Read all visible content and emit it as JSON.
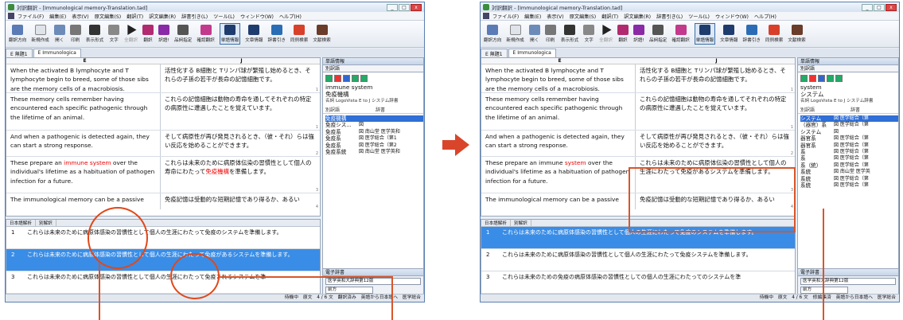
{
  "title": "対訳翻訳 - [Immunological memory-Translation.tad]",
  "menu": [
    "ファイル(F)",
    "編集(E)",
    "表示(V)",
    "原文編集(S)",
    "翻訳(T)",
    "訳文編集(R)",
    "辞書引き(L)",
    "ツール(L)",
    "ウィンドウ(W)",
    "ヘルプ(H)"
  ],
  "toolbar": [
    "翻訳方向",
    "新規作成",
    "開く",
    "印刷",
    "表示形式",
    "文字",
    "全翻訳",
    "翻訳",
    "訳語!",
    "訳語",
    "品詞指定",
    "確認翻訳",
    "単語情報",
    "文章情報",
    "辞書引き",
    "同例検索",
    "文献検索"
  ],
  "tabs": [
    "E 無題1",
    "E Immunologica"
  ],
  "colheads": {
    "e": "E",
    "j": "J"
  },
  "rows": [
    {
      "e1": "When the activated B lymphocyte and T lymphocyte begin to breed, some of those sibs are the memory cells of a macrobiosis.",
      "j1": "活性化する B細胞と Tリンパ球が繁殖し始めるとき、それらの子孫の若干が長命の記憶細胞です。",
      "n": "1"
    },
    {
      "e1": "These memory cells remember having encountered each specific pathogenic through the lifetime of an animal.",
      "j1": "これらの記憶細胞は動物の寿命を通してそれぞれの特定の病原性に遭遇したことを覚えています。",
      "n": "1"
    },
    {
      "e1": "And when a pathogenic is detected again, they can start a strong response.",
      "j1": "そして病原性が再び発見されるとき、（彼・それ）らは強い反応を始めることができます。",
      "n": "2"
    },
    {
      "e_pre": "These prepare an ",
      "e_red1": "immune",
      "e_sp": " ",
      "e_red2": "system",
      "e_post": " over the individual's lifetime as a habituation of pathogen infection for a future.",
      "j_pre": "これらは未来のために病原体伝染の習慣性として個人の寿命にわたって",
      "j_red": "免疫機構",
      "j_post": "を準備します。",
      "n": "3"
    },
    {
      "e1": "The immunological memory can be a passive",
      "j1": "免疫記憶は受動的な短期記憶であり得るか、あるい",
      "n": "4"
    }
  ],
  "right_rows3": {
    "j1": "これらは未来のために病原体伝染の習慣性として個人の生涯にわたって免疫があるシステムを準備します。"
  },
  "dict_left": {
    "header": "単語情報",
    "ref": "別訳語",
    "word_en": "immune system",
    "word_ja": "免疫機構",
    "source": "名詞 LogoVista E to J システム辞書",
    "cols": [
      "別訳語",
      "辞書"
    ],
    "items": [
      {
        "a": "免疫機構",
        "b": "",
        "sel": true
      },
      {
        "a": "免疫シス...",
        "b": "図"
      },
      {
        "a": "免疫系",
        "b": "図 南山堂 医学英和"
      },
      {
        "a": "免疫系",
        "b": "図 医学総合（第1"
      },
      {
        "a": "免疫系",
        "b": "図 医学総合（第2"
      },
      {
        "a": "免疫系統",
        "b": "図 南山堂 医学英和"
      }
    ]
  },
  "dict_right": {
    "header": "単語情報",
    "ref": "別訳語",
    "word_en": "system",
    "word_ja": "システム",
    "source": "名詞 LogoVista E to J システム辞書",
    "cols": [
      "別訳語",
      "辞書"
    ],
    "items": [
      {
        "a": "システム",
        "b": "図 医学総合（第",
        "sel": true
      },
      {
        "a": "（器官）系",
        "b": "図 医学総合（第"
      },
      {
        "a": "システム",
        "b": "図"
      },
      {
        "a": "器官系",
        "b": "図 医学総合（第"
      },
      {
        "a": "器官系",
        "b": "図 医学総合（第"
      },
      {
        "a": "系",
        "b": "図 医学総合（第"
      },
      {
        "a": "系",
        "b": "図 医学総合（第"
      },
      {
        "a": "系（統）",
        "b": "図 医学総合（第"
      },
      {
        "a": "系統",
        "b": "図 南山堂 医学英"
      },
      {
        "a": "系統",
        "b": "図 医学総合（第"
      },
      {
        "a": "系統",
        "b": "図 医学総合（第"
      }
    ]
  },
  "edict": {
    "label": "電子辞書",
    "select": "医学英和大辞典第12版",
    "mode": "前方"
  },
  "bottom": {
    "tabs": [
      "日本語解析",
      "別解訳"
    ],
    "left": [
      {
        "n": "1",
        "t": "これらは未来のために病原体感染の習慣性として個人の生涯にわたって免疫のシステムを準備します。"
      },
      {
        "n": "2",
        "t": "これらは未来のために病原体感染の習慣性として個人の生涯にわたって免疫があるシステムを準備します。",
        "sel": true
      },
      {
        "n": "3",
        "t": "これらは未来のために病原体感染の習慣性として個人の生涯にわたって免疫されるシステムを準"
      }
    ],
    "right": [
      {
        "n": "1",
        "t": "これらは未来のために病原体感染の習慣性として個人の生涯にわたって免疫のシステムを準備します。",
        "sel": true
      },
      {
        "n": "2",
        "t": "これらは未来のために病原体感染の習慣性として個人の生涯にわたって免疫システムを準備します。"
      },
      {
        "n": "3",
        "t": "これらは未来のための免疫の病原体感染の習慣性としての個人の生涯にわたってのシステムを準"
      }
    ]
  },
  "status_left": "待機中　原文　4 / 6 文　翻訳済み　英語から日本語へ　医学総合",
  "status_right": "待機中　原文　4 / 6 文　修編集済　英語から日本語へ　医学総合"
}
